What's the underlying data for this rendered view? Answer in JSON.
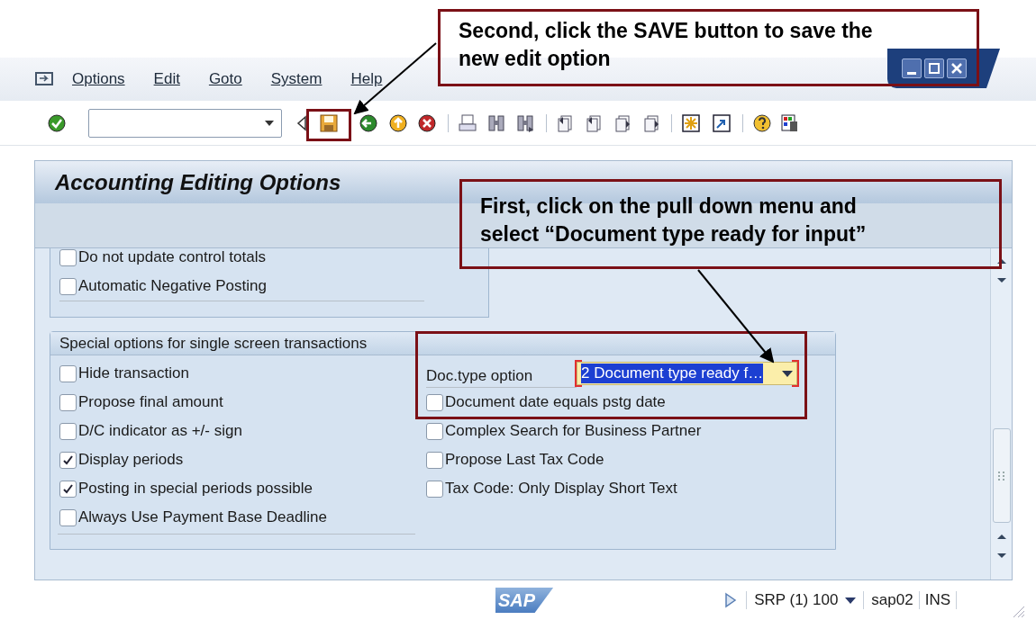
{
  "callouts": [
    {
      "text": "Second, click the SAVE button to save the new edit option"
    },
    {
      "text": "First, click on the pull down menu and select “Document type ready for input”"
    }
  ],
  "menu_bar": {
    "items": [
      {
        "label": "Options"
      },
      {
        "label": "Edit"
      },
      {
        "label": "Goto"
      },
      {
        "label": "System"
      },
      {
        "label": "Help"
      }
    ]
  },
  "panel": {
    "title": "Accounting Editing Options",
    "upper_group": {
      "items": [
        {
          "label": "Do not update control totals",
          "checked": false
        },
        {
          "label": "Automatic Negative Posting",
          "checked": false
        }
      ]
    },
    "special_group": {
      "title": "Special options for single screen transactions",
      "left_items": [
        {
          "label": "Hide transaction",
          "checked": false
        },
        {
          "label": "Propose final amount",
          "checked": false
        },
        {
          "label": "D/C indicator as +/- sign",
          "checked": false
        },
        {
          "label": "Display periods",
          "checked": true
        },
        {
          "label": "Posting in special periods possible",
          "checked": true
        },
        {
          "label": "Always Use Payment Base Deadline",
          "checked": false
        }
      ],
      "right_items": [
        {
          "kind": "dropdown",
          "label": "Doc.type option",
          "value": "2 Document type ready f…"
        },
        {
          "kind": "checkbox",
          "label": "Document date equals pstg date",
          "checked": false
        },
        {
          "kind": "checkbox",
          "label": "Complex Search for Business Partner",
          "checked": false
        },
        {
          "kind": "checkbox",
          "label": "Propose Last Tax Code",
          "checked": false
        },
        {
          "kind": "checkbox",
          "label": "Tax Code: Only Display Short Text",
          "checked": false
        }
      ]
    }
  },
  "status_bar": {
    "logo": "SAP",
    "system": "SRP (1) 100",
    "server": "sap02",
    "mode": "INS"
  }
}
